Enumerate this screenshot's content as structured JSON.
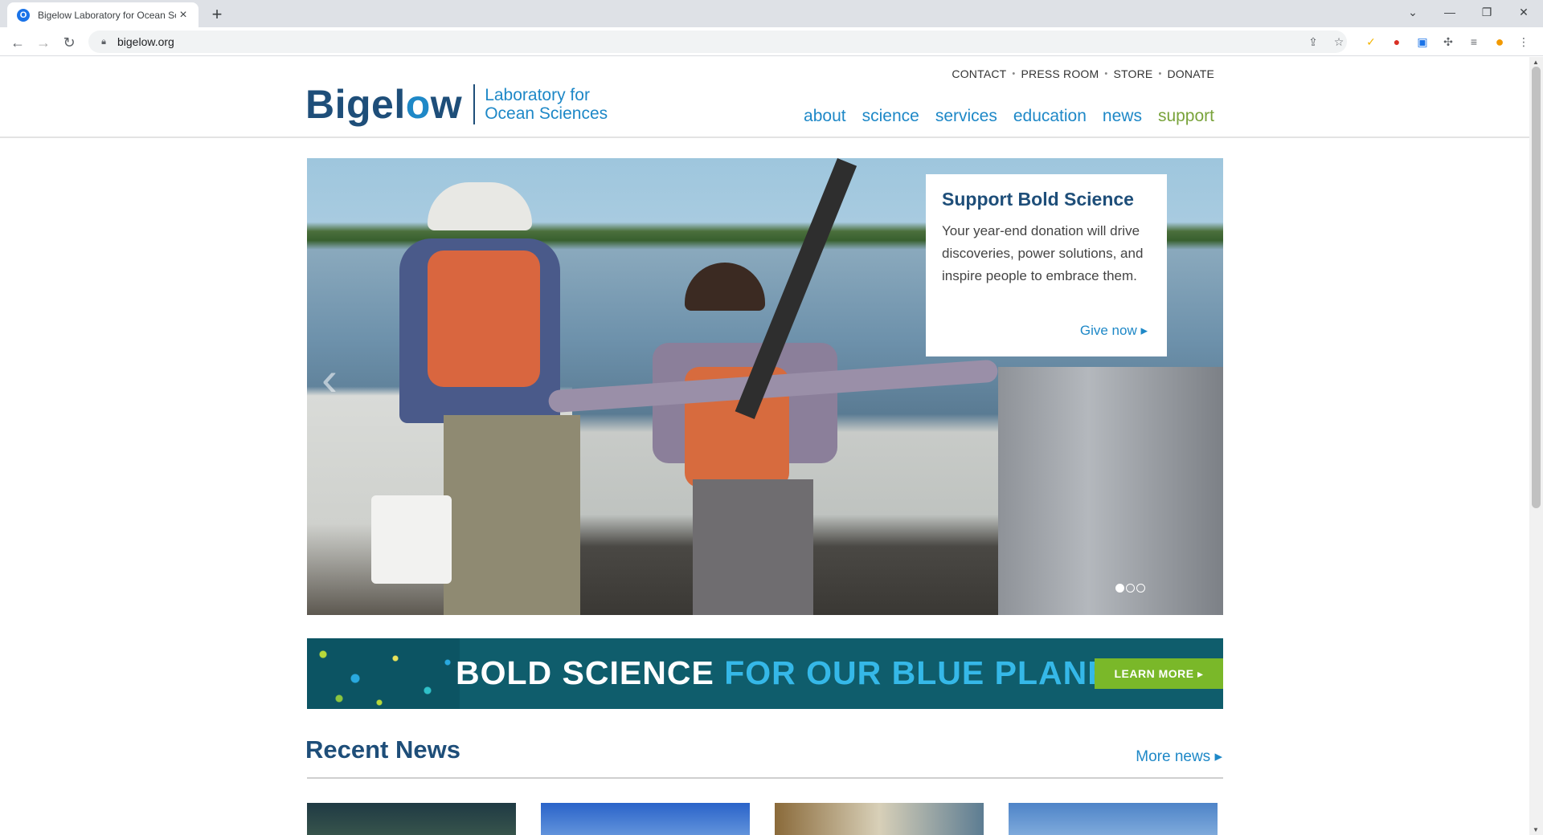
{
  "browser": {
    "tab_title": "Bigelow Laboratory for Ocean Sciences",
    "favicon_letter": "O",
    "url": "bigelow.org",
    "new_tab": "+",
    "close_tab": "×"
  },
  "header": {
    "utility_links": [
      "CONTACT",
      "PRESS ROOM",
      "STORE",
      "DONATE"
    ],
    "logo_main_a": "Bigel",
    "logo_main_b": "o",
    "logo_main_c": "w",
    "logo_line1": "Laboratory for",
    "logo_line2": "Ocean Sciences",
    "nav": [
      "about",
      "science",
      "services",
      "education",
      "news",
      "support"
    ]
  },
  "hero": {
    "heading": "Support Bold Science",
    "text": "Your year-end donation will drive discoveries, power solutions, and inspire people to embrace them.",
    "cta": "Give now ▸",
    "prev_arrow": "‹",
    "slide_count": 3,
    "active_slide": 1
  },
  "banner": {
    "text_white": "BOLD SCIENCE",
    "text_blue": "FOR OUR BLUE PLANET",
    "button": "LEARN MORE ▸"
  },
  "news": {
    "heading": "Recent News",
    "more": "More news ▸"
  },
  "colors": {
    "brand_dark": "#1e4e79",
    "brand_blue": "#1e88c7",
    "support_green": "#79a33b",
    "banner_bg": "#0f5d6c",
    "learn_green": "#7ab829"
  }
}
